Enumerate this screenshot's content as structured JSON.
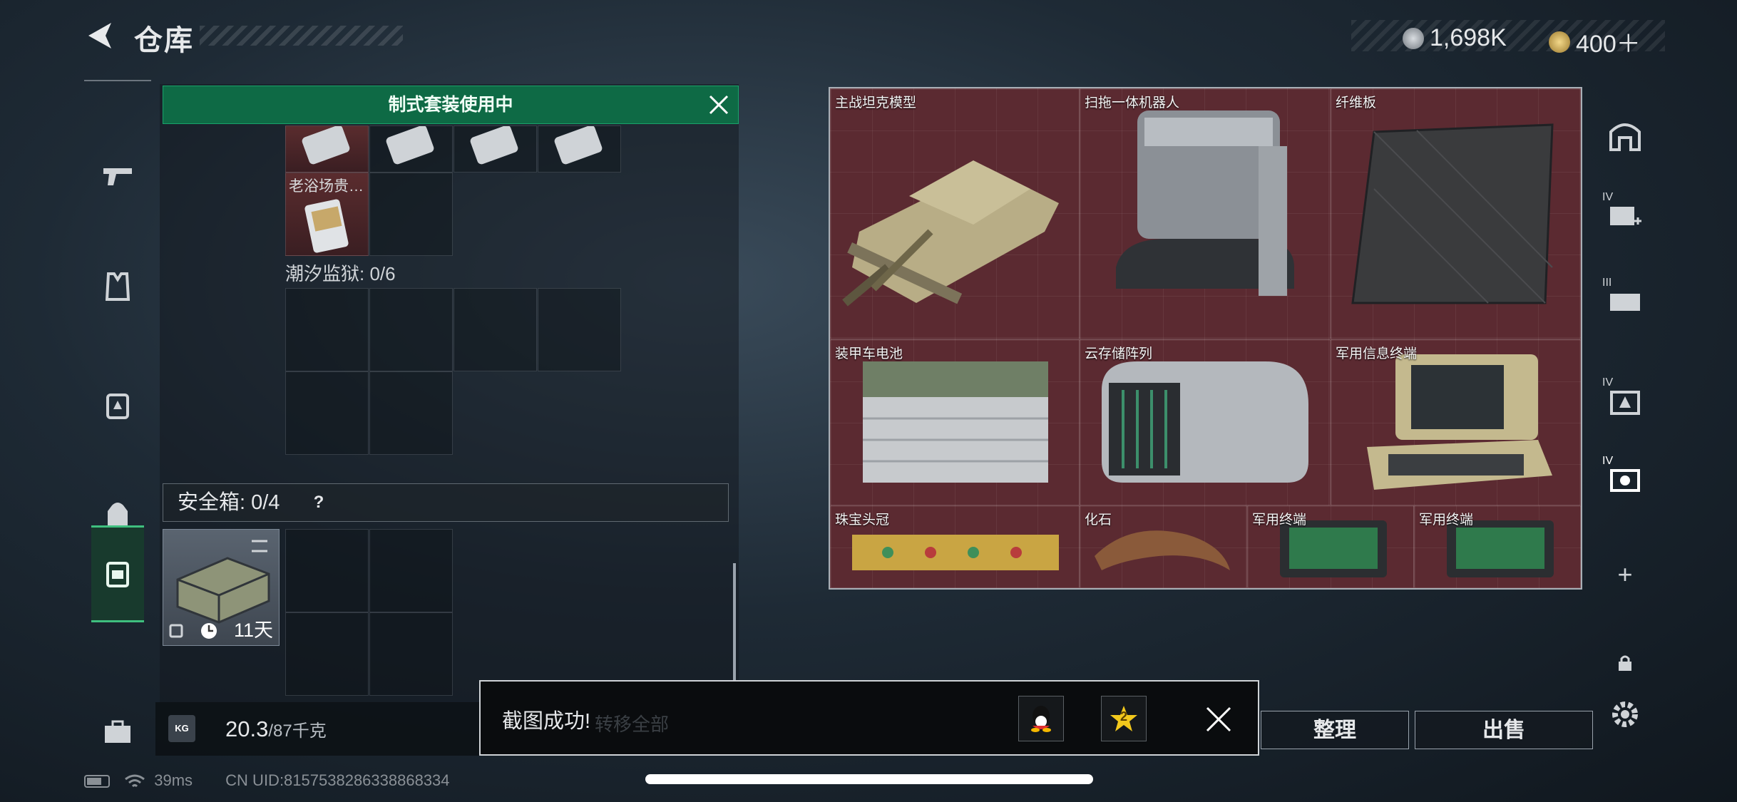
{
  "header": {
    "title": "仓库",
    "currencies": [
      {
        "icon": "coin-silver-icon",
        "value": "1,698K"
      },
      {
        "icon": "coin-gold-icon",
        "value": "400＋"
      }
    ]
  },
  "left_rail": [
    "pistol-icon",
    "vest-icon",
    "backpack-rig-icon",
    "backpack-icon",
    "case-icon",
    "toolbox-icon"
  ],
  "kit_banner": {
    "text": "制式套装使用中"
  },
  "inventory": {
    "item_label": "老浴场贵…",
    "section_label": "潮汐监狱: 0/6",
    "safe_box_label": "安全箱: 0/4",
    "safe_box_help": "?",
    "case_days": "11天",
    "weight_value": "20.3",
    "weight_max": "/87千克",
    "weight_icon": "KG"
  },
  "storage_items": [
    {
      "name": "主战坦克模型"
    },
    {
      "name": "扫拖一体机器人"
    },
    {
      "name": "纤维板"
    },
    {
      "name": "装甲车电池"
    },
    {
      "name": "云存储阵列"
    },
    {
      "name": "军用信息终端"
    },
    {
      "name": "珠宝头冠"
    },
    {
      "name": "化石"
    },
    {
      "name": "军用终端"
    },
    {
      "name": "军用终端"
    }
  ],
  "right_rail": {
    "tiers": [
      "IV",
      "III",
      "IV",
      "IV"
    ],
    "plus": "+"
  },
  "buttons": {
    "sort": "整理",
    "sell": "出售",
    "hidden": "转移全部"
  },
  "toast": {
    "text": "截图成功!",
    "badge": "2"
  },
  "status": {
    "ping": "39ms",
    "uid": "CN UID:8157538286338868334"
  }
}
